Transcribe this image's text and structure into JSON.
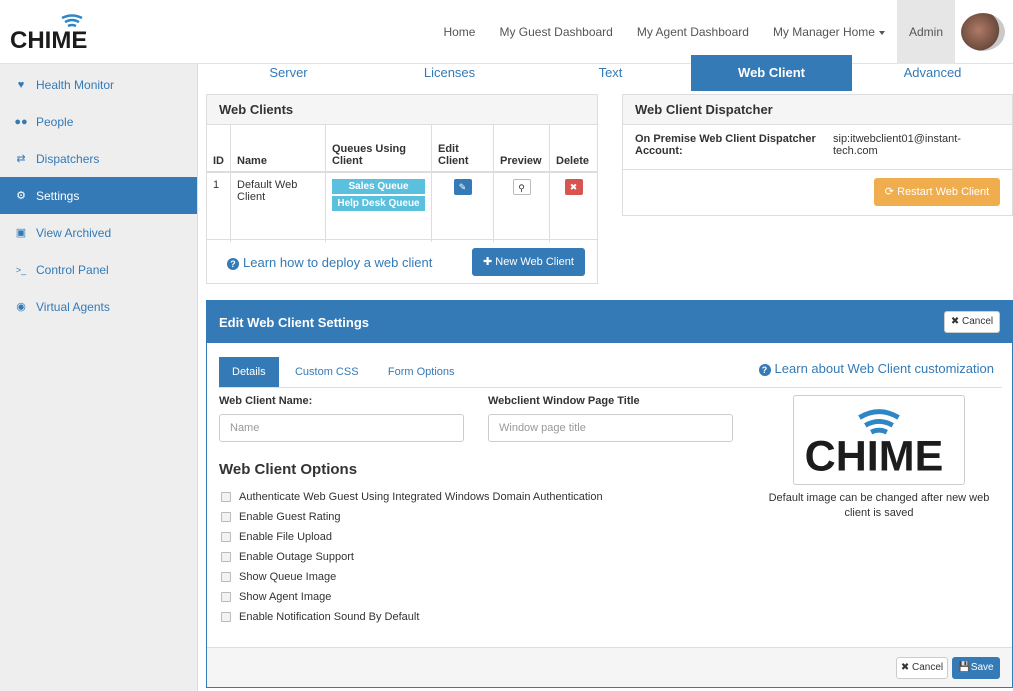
{
  "brand": {
    "logo_text": "CHIME",
    "accent": "#337ab7",
    "logo_blue": "#2f86c5"
  },
  "topnav": {
    "items": [
      "Home",
      "My Guest Dashboard",
      "My Agent Dashboard",
      "My Manager Home"
    ],
    "admin": "Admin"
  },
  "sidebar": {
    "items": [
      {
        "label": "Health Monitor",
        "icon": "heartbeat-icon"
      },
      {
        "label": "People",
        "icon": "users-icon"
      },
      {
        "label": "Dispatchers",
        "icon": "exchange-icon"
      },
      {
        "label": "Settings",
        "icon": "cogs-icon",
        "active": true
      },
      {
        "label": "View Archived",
        "icon": "archive-icon"
      },
      {
        "label": "Control Panel",
        "icon": "terminal-icon"
      },
      {
        "label": "Virtual Agents",
        "icon": "robot-icon"
      }
    ]
  },
  "tabs": [
    "Server",
    "Licenses",
    "Text",
    "Web Client",
    "Advanced"
  ],
  "active_tab": "Web Client",
  "web_clients": {
    "title": "Web Clients",
    "headers": [
      "ID",
      "Name",
      "Queues Using Client",
      "Edit Client",
      "Preview",
      "Delete"
    ],
    "rows": [
      {
        "id": "1",
        "name": "Default Web Client",
        "queues": [
          "Sales Queue",
          "Help Desk Queue"
        ]
      }
    ],
    "learn_link": "Learn how to deploy a web client",
    "new_button": "New Web Client"
  },
  "dispatcher": {
    "title": "Web Client Dispatcher",
    "label": "On Premise Web Client Dispatcher Account:",
    "value": "sip:itwebclient01@instant-tech.com",
    "restart_button": "Restart Web Client"
  },
  "edit": {
    "title": "Edit Web Client Settings",
    "cancel_top": "Cancel",
    "subtabs": [
      "Details",
      "Custom CSS",
      "Form Options"
    ],
    "learn_link": "Learn about Web Client customization",
    "name_label": "Web Client Name:",
    "name_placeholder": "Name",
    "title_label": "Webclient Window Page Title",
    "title_placeholder": "Window page title",
    "options_title": "Web Client Options",
    "options": [
      "Authenticate Web Guest Using Integrated Windows Domain Authentication",
      "Enable Guest Rating",
      "Enable File Upload",
      "Enable Outage Support",
      "Show Queue Image",
      "Show Agent Image",
      "Enable Notification Sound By Default"
    ],
    "image_caption": "Default image can be changed after new web client is saved",
    "cancel_bottom": "Cancel",
    "save": "Save"
  }
}
